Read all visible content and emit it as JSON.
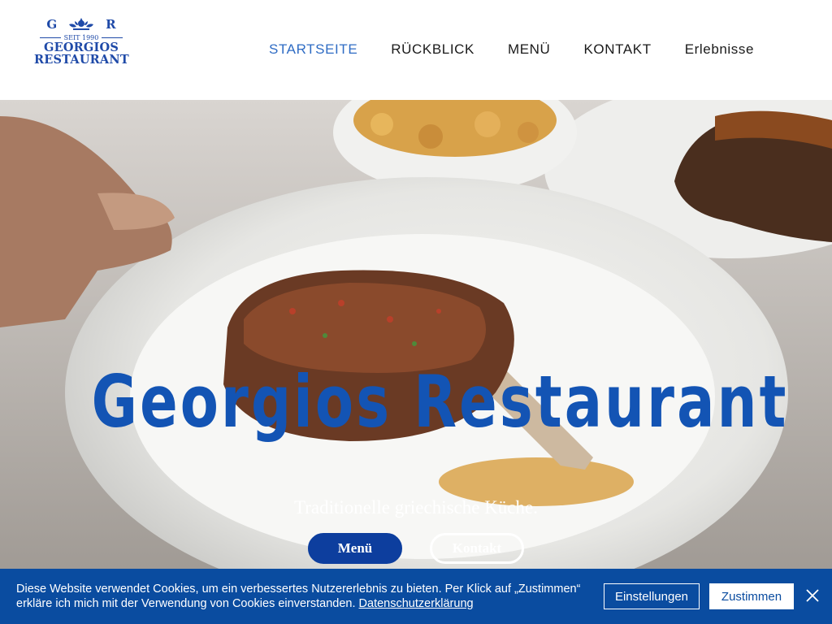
{
  "logo": {
    "letter_left": "G",
    "letter_right": "R",
    "since": "SEIT 1990",
    "name_line1": "GEORGIOS",
    "name_line2": "RESTAURANT"
  },
  "nav": {
    "items": [
      {
        "label": "STARTSEITE",
        "active": true
      },
      {
        "label": "RÜCKBLICK"
      },
      {
        "label": "MENÜ"
      },
      {
        "label": "KONTAKT"
      },
      {
        "label": "Erlebnisse"
      }
    ]
  },
  "hero": {
    "title": "Georgios Restaurant",
    "subtitle": "Traditionelle griechische Küche.",
    "menu_button": "Menü",
    "contact_button": "Kontakt"
  },
  "cookie": {
    "text": "Diese Website verwendet Cookies, um ein verbessertes Nutzererlebnis zu bieten. Per Klick auf „Zustimmen“ erkläre ich mich mit der Verwendung von Cookies einverstanden.",
    "link": "Datenschutzerklärung",
    "settings_button": "Einstellungen",
    "accept_button": "Zustimmen"
  },
  "colors": {
    "brand_blue": "#1354b4",
    "nav_active": "#2f6cc4",
    "cookie_bar": "#0a4ca0",
    "button_blue": "#0d3e9e"
  },
  "icons": {
    "logo_emblem": "flower-emblem-icon",
    "close": "close-icon"
  }
}
